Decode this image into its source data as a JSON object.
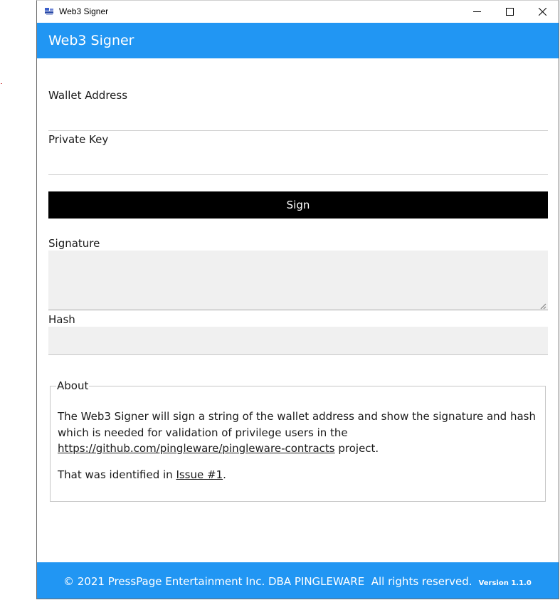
{
  "window": {
    "title": "Web3 Signer",
    "buttons": [
      "minimize",
      "maximize",
      "close"
    ]
  },
  "header": {
    "title": "Web3 Signer"
  },
  "form": {
    "wallet_label": "Wallet Address",
    "wallet_value": "",
    "private_key_label": "Private Key",
    "private_key_value": "",
    "sign_button": "Sign",
    "signature_label": "Signature",
    "signature_value": "",
    "hash_label": "Hash",
    "hash_value": ""
  },
  "about": {
    "legend": "About",
    "para1_text": "The Web3 Signer will sign a string of the wallet address and show the signature and hash which is needed for validation of privilege users in the ",
    "para1_link": "https://github.com/pingleware/pingleware-contracts",
    "para1_suffix": " project.",
    "para2_prefix": "That was identified in ",
    "para2_link": "Issue #1",
    "para2_suffix": "."
  },
  "footer": {
    "copyright": "© 2021 PressPage Entertainment Inc. DBA PINGLEWARE  All rights reserved.",
    "version": "Version 1.1.0"
  },
  "colors": {
    "accent": "#2196f3",
    "button_bg": "#000000",
    "field_bg": "#f0f0f0"
  },
  "icons": {
    "app": "app-icon",
    "minimize": "minimize-icon",
    "maximize": "maximize-icon",
    "close": "close-icon",
    "resize": "resize-grip-icon"
  }
}
